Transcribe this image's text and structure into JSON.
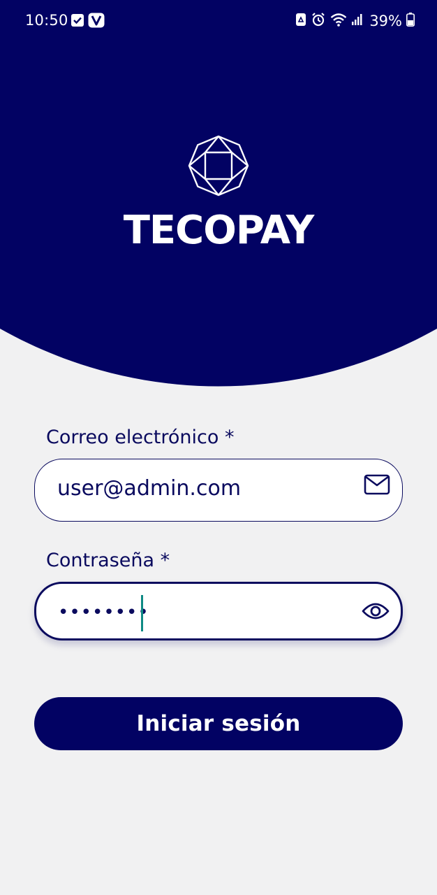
{
  "colors": {
    "brand": "#020263",
    "background": "#f1f1f2",
    "cursor": "#0e8a84"
  },
  "status_bar": {
    "time": "10:50",
    "battery": "39%",
    "icons": [
      "checkbox-notification-icon",
      "v-notification-icon",
      "recycle-icon",
      "alarm-icon",
      "wifi-icon",
      "signal-icon",
      "battery-icon"
    ]
  },
  "brand": {
    "name": "TECOPAY",
    "logo_icon": "gem-icon"
  },
  "form": {
    "email": {
      "label": "Correo electrónico *",
      "value": "user@admin.com",
      "icon": "mail-icon"
    },
    "password": {
      "label": "Contraseña *",
      "value": "••••••••",
      "icon": "eye-icon"
    },
    "submit_label": "Iniciar sesión"
  }
}
